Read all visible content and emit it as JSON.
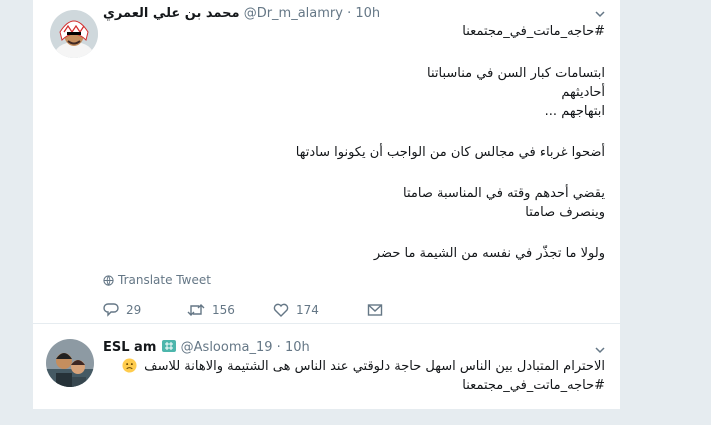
{
  "tweet1": {
    "author_name": "محمد بن علي العمري",
    "handle": "@Dr_m_alamry",
    "separator": "·",
    "time": "10h",
    "hashtag": "#حاجه_ماتت_في_مجتمعنا",
    "lines": [
      "ابتسامات كبار السن في مناسباتنا",
      "أحاديثهم",
      "ابتهاجهم ...",
      "أضحوا غرباء في مجالس كان من الواجب أن يكونوا سادتها",
      "يقضي أحدهم وقته في المناسبة صامتا",
      "وينصرف صامتا",
      "ولولا ما تجذّر في نفسه من الشيمة ما حضر"
    ],
    "translate_label": "Translate Tweet",
    "reply_count": "29",
    "retweet_count": "156",
    "like_count": "174"
  },
  "tweet2": {
    "author_name": "ESL am",
    "handle": "@Aslooma_19",
    "separator": "·",
    "time": "10h",
    "text": "الاحترام المتبادل بين الناس اسهل حاجة دلوقتي عند الناس هى الشتيمة والاهانة للاسف",
    "emoji": "🙁",
    "hashtag": "#حاجه_ماتت_في_مجتمعنا"
  },
  "colors": {
    "link": "#1b95e0",
    "text": "#14171a",
    "muted": "#657786",
    "background": "#e6ecf0"
  },
  "icons": [
    "chevron-down-icon",
    "globe-icon",
    "reply-icon",
    "retweet-icon",
    "like-icon",
    "dm-icon",
    "verified-badge-icon",
    "sad-face-emoji"
  ]
}
